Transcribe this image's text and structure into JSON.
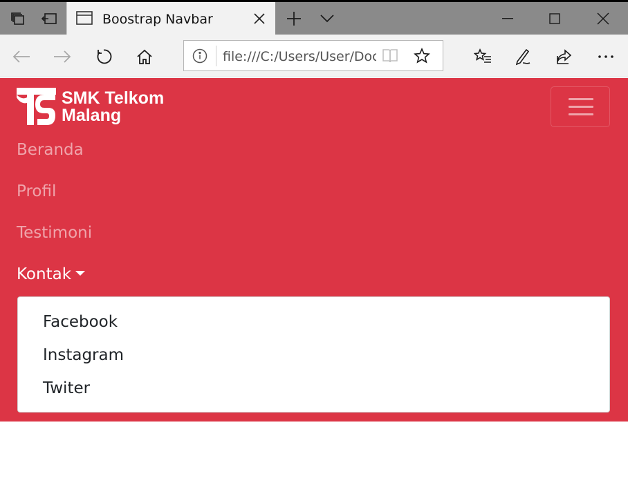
{
  "browser": {
    "tab_title": "Boostrap Navbar",
    "address_url": "file:///C:/Users/User/Documents/navbar.html",
    "icons": {
      "tab_actions": "tabs-aside-icon",
      "set_aside": "set-aside-icon",
      "new_tab": "plus-icon",
      "tab_list": "chevron-down-icon",
      "minimize": "minimize-icon",
      "maximize": "maximize-icon",
      "close": "close-icon",
      "back": "arrow-left-icon",
      "forward": "arrow-right-icon",
      "refresh": "refresh-icon",
      "home": "home-icon",
      "info": "info-icon",
      "reading_view": "book-icon",
      "favorite": "star-icon",
      "favorites_hub": "favorites-list-icon",
      "notes": "pen-icon",
      "share": "share-icon",
      "more": "ellipsis-icon"
    }
  },
  "page": {
    "accent_color": "#dc3545",
    "brand": {
      "line1": "SMK Telkom",
      "line2": "Malang"
    },
    "nav": {
      "items": [
        {
          "label": "Beranda"
        },
        {
          "label": "Profil"
        },
        {
          "label": "Testimoni"
        },
        {
          "label": "Kontak"
        }
      ],
      "dropdown_items": [
        {
          "label": "Facebook"
        },
        {
          "label": "Instagram"
        },
        {
          "label": "Twiter"
        }
      ]
    }
  }
}
